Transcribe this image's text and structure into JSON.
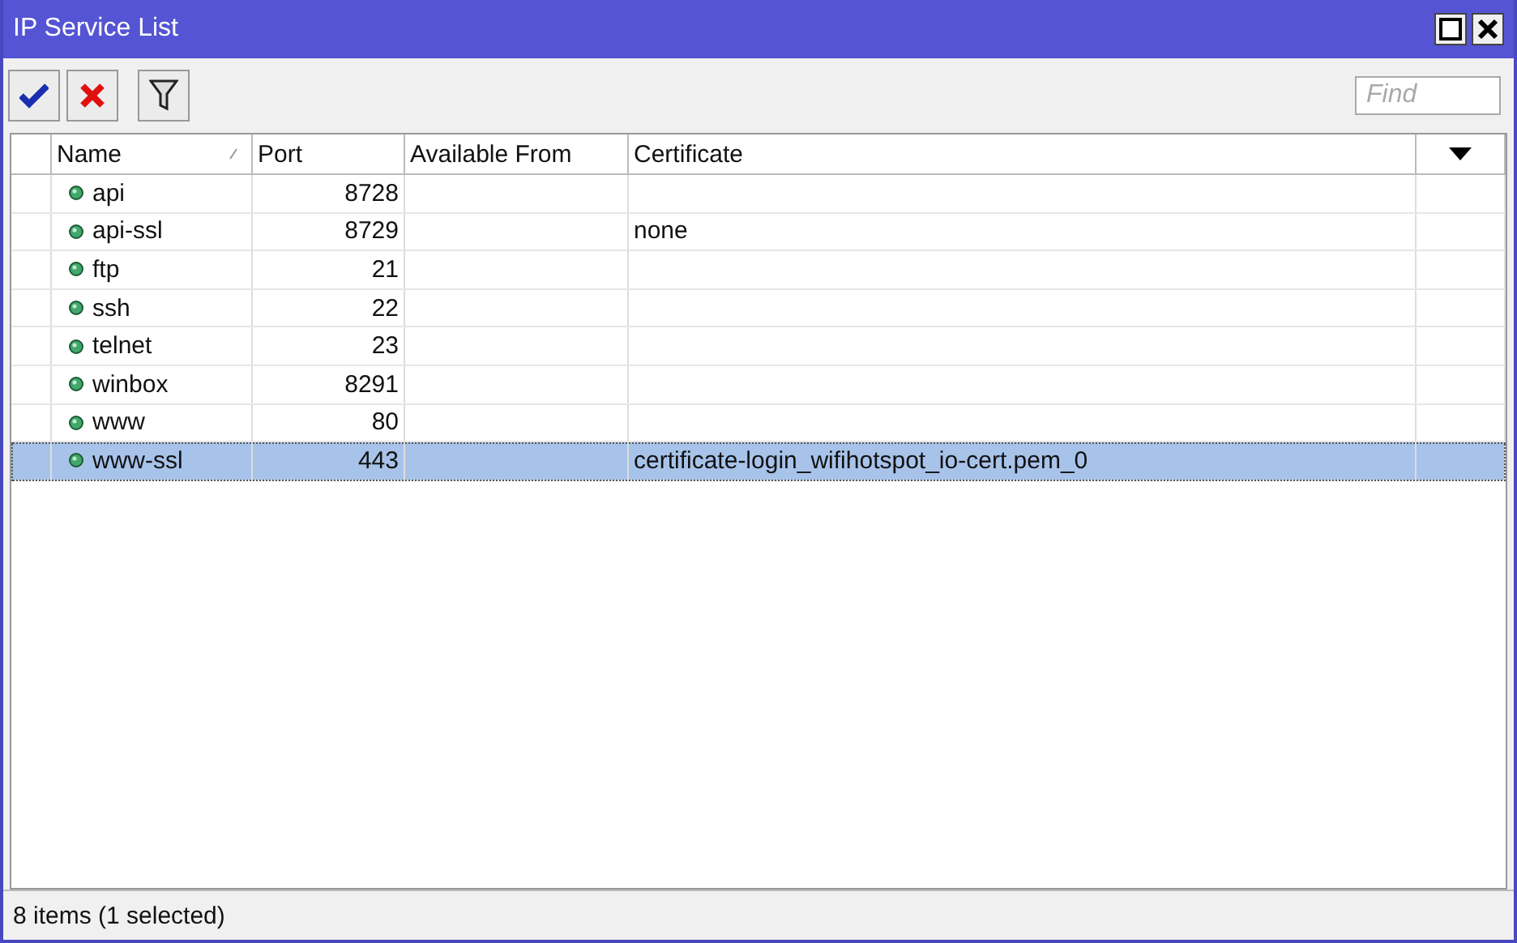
{
  "window": {
    "title": "IP Service List"
  },
  "toolbar": {
    "find": {
      "placeholder": "Find"
    }
  },
  "table": {
    "columns": [
      "Name",
      "Port",
      "Available From",
      "Certificate"
    ],
    "rows": [
      {
        "name": "api",
        "port": "8728",
        "available_from": "",
        "certificate": "",
        "selected": false
      },
      {
        "name": "api-ssl",
        "port": "8729",
        "available_from": "",
        "certificate": "none",
        "selected": false
      },
      {
        "name": "ftp",
        "port": "21",
        "available_from": "",
        "certificate": "",
        "selected": false
      },
      {
        "name": "ssh",
        "port": "22",
        "available_from": "",
        "certificate": "",
        "selected": false
      },
      {
        "name": "telnet",
        "port": "23",
        "available_from": "",
        "certificate": "",
        "selected": false
      },
      {
        "name": "winbox",
        "port": "8291",
        "available_from": "",
        "certificate": "",
        "selected": false
      },
      {
        "name": "www",
        "port": "80",
        "available_from": "",
        "certificate": "",
        "selected": false
      },
      {
        "name": "www-ssl",
        "port": "443",
        "available_from": "",
        "certificate": "certificate-login_wifihotspot_io-cert.pem_0",
        "selected": true
      }
    ]
  },
  "status_bar": "8 items (1 selected)"
}
